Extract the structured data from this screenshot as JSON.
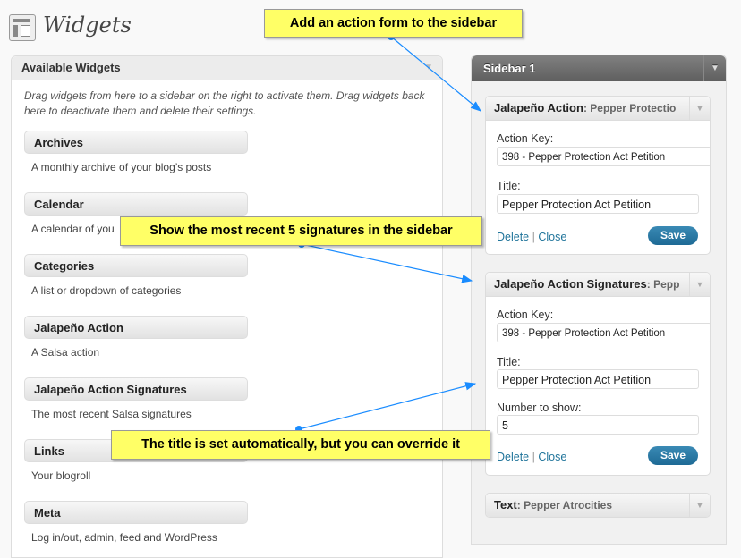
{
  "page": {
    "title": "Widgets"
  },
  "available": {
    "header": "Available Widgets",
    "description": "Drag widgets from here to a sidebar on the right to activate them. Drag widgets back here to deactivate them and delete their settings.",
    "widgets": [
      {
        "name": "Archives",
        "desc": "A monthly archive of your blog’s posts"
      },
      {
        "name": "Calendar",
        "desc": "A calendar of you"
      },
      {
        "name": "Categories",
        "desc": "A list or dropdown of categories"
      },
      {
        "name": "Jalapeño Action",
        "desc": "A Salsa action"
      },
      {
        "name": "Jalapeño Action Signatures",
        "desc": "The most recent Salsa signatures"
      },
      {
        "name": "Links",
        "desc": "Your blogroll"
      },
      {
        "name": "Meta",
        "desc": "Log in/out, admin, feed and WordPress"
      }
    ]
  },
  "sidebar": {
    "title": "Sidebar 1",
    "w1": {
      "name": "Jalapeño Action",
      "sub": ": Pepper Protectio",
      "key_label": "Action Key:",
      "key_value": "398 - Pepper Protection Act Petition",
      "title_label": "Title:",
      "title_value": "Pepper Protection Act Petition",
      "delete": "Delete",
      "sep": "|",
      "close": "Close",
      "save": "Save"
    },
    "w2": {
      "name": "Jalapeño Action Signatures",
      "sub": ": Pepp",
      "key_label": "Action Key:",
      "key_value": "398 - Pepper Protection Act Petition",
      "title_label": "Title:",
      "title_value": "Pepper Protection Act Petition",
      "num_label": "Number to show:",
      "num_value": "5",
      "delete": "Delete",
      "sep": "|",
      "close": "Close",
      "save": "Save"
    },
    "w3": {
      "name": "Text",
      "sub": ": Pepper Atrocities"
    }
  },
  "callouts": {
    "c1": "Add an action form to the sidebar",
    "c2": "Show the most recent 5 signatures in the sidebar",
    "c3": "The title is set automatically, but you can override it"
  },
  "colors": {
    "callout_bg": "#ffff66",
    "arrow": "#1a8cff",
    "save_button": "#21759b"
  }
}
